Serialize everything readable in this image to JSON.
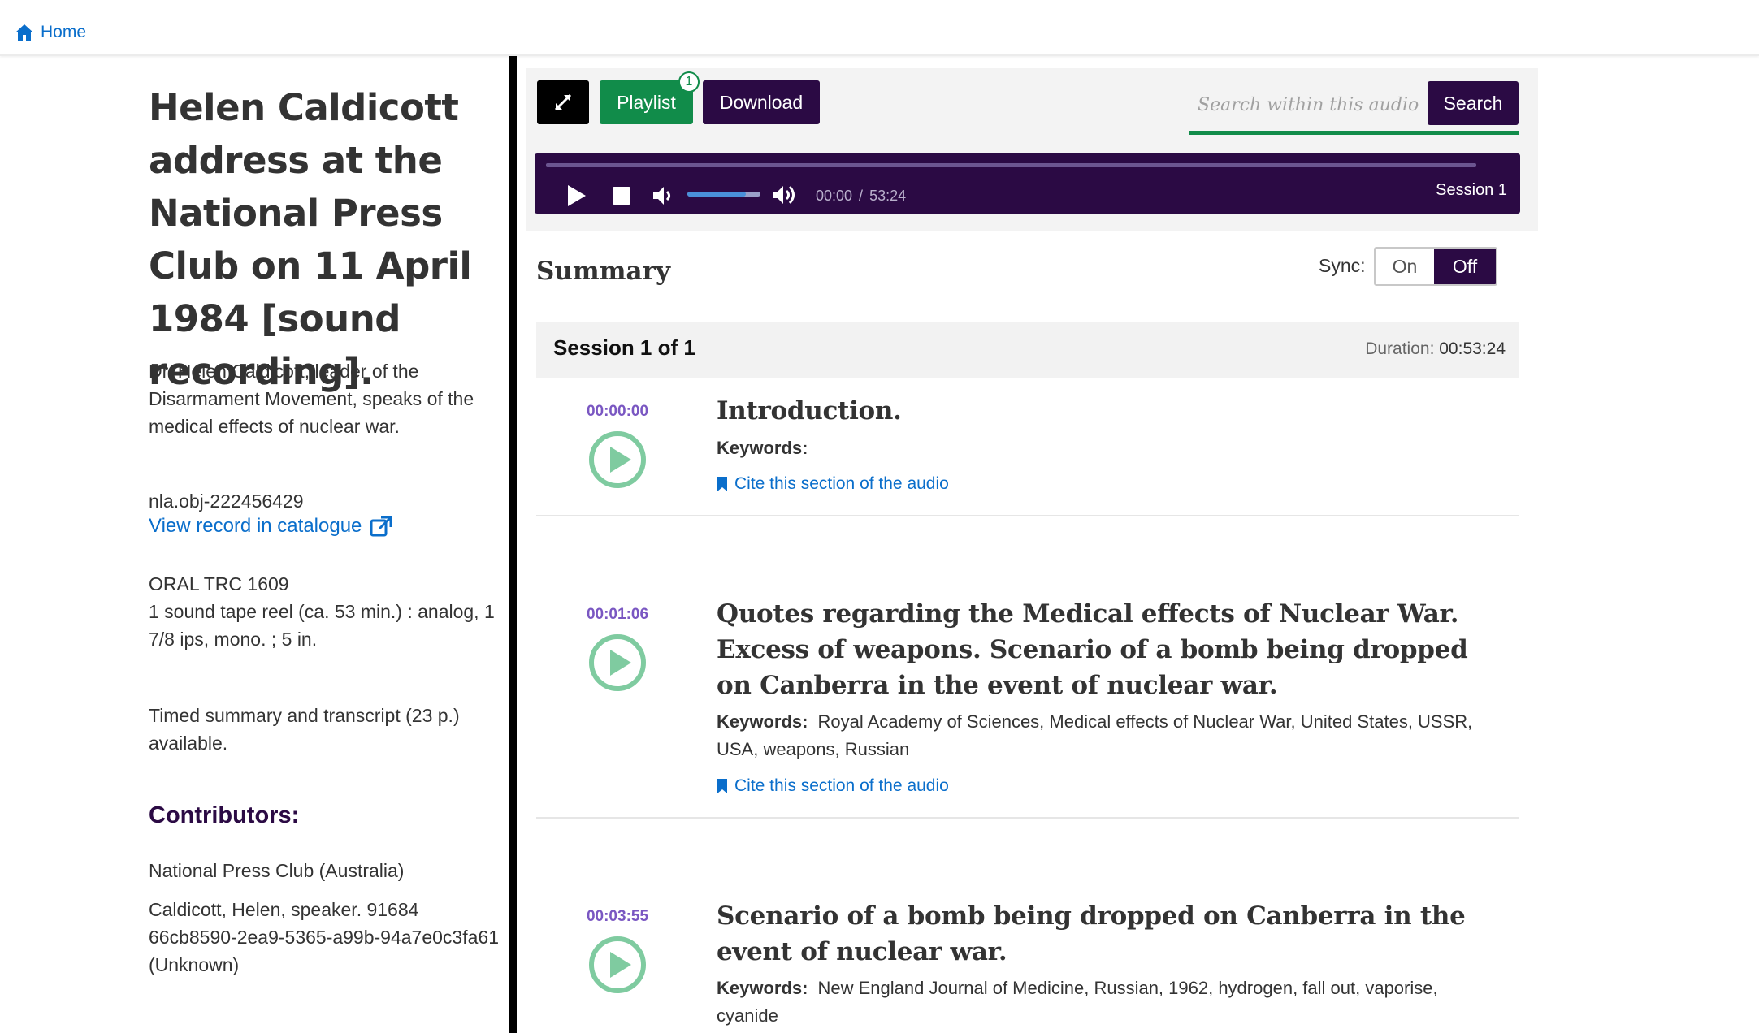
{
  "nav": {
    "home_label": "Home"
  },
  "record": {
    "title": "Helen Caldicott address at the National Press Club on 11 April 1984 [sound recording].",
    "description": "Dr. Helen Caldicott, leader of the Disarmament Movement, speaks of the medical effects of nuclear war.",
    "object_id": "nla.obj-222456429",
    "catalogue_link": "View record in catalogue",
    "call_number": "ORAL TRC 1609",
    "physical_desc": "1 sound tape reel (ca. 53 min.) : analog, 1 7/8 ips, mono. ; 5 in.",
    "summary_note": "Timed summary and transcript (23 p.) available.",
    "contributors_heading": "Contributors:",
    "contributors": [
      "National Press Club (Australia)",
      "Caldicott, Helen, speaker. 91684 66cb8590-2ea9-5365-a99b-94a7e0c3fa61 (Unknown)"
    ]
  },
  "toolbar": {
    "playlist_label": "Playlist",
    "playlist_count": "1",
    "download_label": "Download",
    "search_placeholder": "Search within this audio...",
    "search_button": "Search"
  },
  "player": {
    "current_time": "00:00",
    "time_separator": "/",
    "total_time": "53:24",
    "session_name": "Session 1",
    "volume_level": 0.8,
    "progress": 0
  },
  "summary": {
    "heading": "Summary",
    "sync_label": "Sync:",
    "sync_on": "On",
    "sync_off": "Off",
    "session_title": "Session 1 of 1",
    "duration_label": "Duration:",
    "duration_value": "00:53:24"
  },
  "entries": [
    {
      "time": "00:00:00",
      "title": "Introduction.",
      "keywords_label": "Keywords:",
      "keywords": "",
      "cite": "Cite this section of the audio"
    },
    {
      "time": "00:01:06",
      "title": "Quotes regarding the Medical effects of Nuclear War. Excess of weapons. Scenario of a bomb being dropped on Canberra in the event of nuclear war.",
      "keywords_label": "Keywords:",
      "keywords": "Royal Academy of Sciences, Medical effects of Nuclear War, United States, USSR, USA, weapons, Russian",
      "cite": "Cite this section of the audio"
    },
    {
      "time": "00:03:55",
      "title": "Scenario of a bomb being dropped on Canberra in the event of nuclear war.",
      "keywords_label": "Keywords:",
      "keywords": "New England Journal of Medicine, Russian, 1962, hydrogen, fall out, vaporise, cyanide",
      "cite": "Cite this section of the audio"
    }
  ],
  "colors": {
    "accent_purple": "#2b0a44",
    "accent_green": "#118c4a",
    "link_blue": "#0a6ecb",
    "timestamp_purple": "#7a57c2",
    "play_circle_green": "#7fcba0"
  },
  "icons": [
    "home-icon",
    "external-link-icon",
    "expand-icon",
    "play-icon",
    "stop-icon",
    "volume-down-icon",
    "volume-up-icon",
    "bookmark-icon",
    "play-circle-icon"
  ]
}
